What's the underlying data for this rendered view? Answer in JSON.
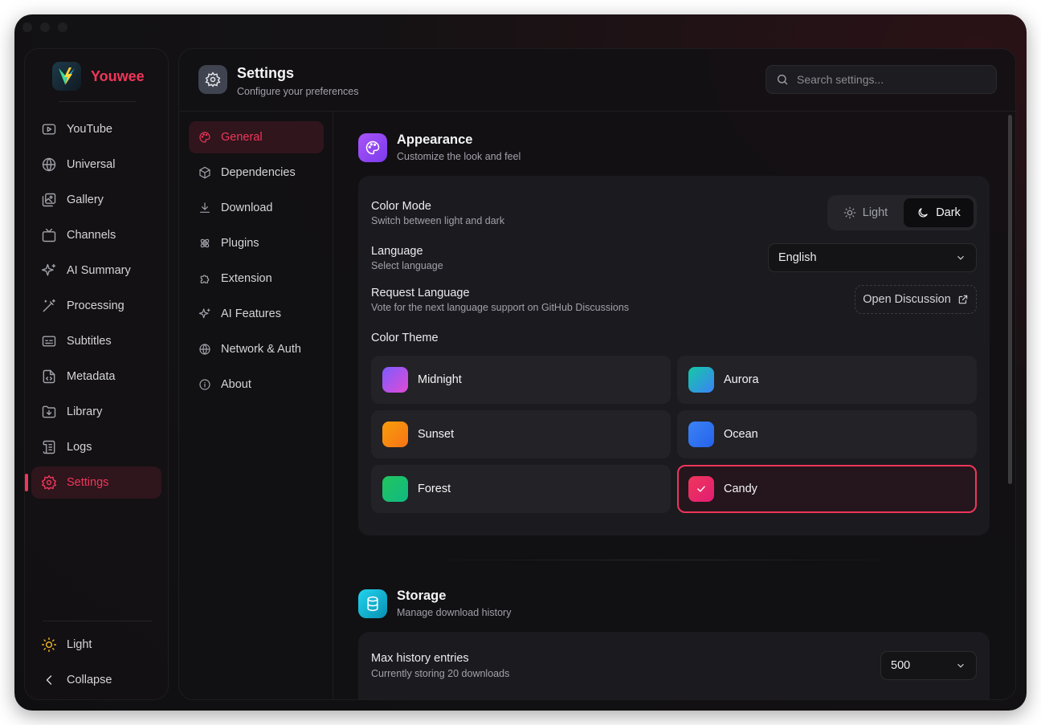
{
  "app": {
    "name": "Youwee",
    "brand_color": "#f0365a"
  },
  "sidebar": {
    "items": [
      {
        "label": "YouTube",
        "icon": "youtube-icon"
      },
      {
        "label": "Universal",
        "icon": "globe-icon"
      },
      {
        "label": "Gallery",
        "icon": "gallery-icon"
      },
      {
        "label": "Channels",
        "icon": "tv-icon"
      },
      {
        "label": "AI Summary",
        "icon": "sparkles-icon"
      },
      {
        "label": "Processing",
        "icon": "wand-icon"
      },
      {
        "label": "Subtitles",
        "icon": "subtitles-icon"
      },
      {
        "label": "Metadata",
        "icon": "file-code-icon"
      },
      {
        "label": "Library",
        "icon": "folder-download-icon"
      },
      {
        "label": "Logs",
        "icon": "scroll-icon"
      },
      {
        "label": "Settings",
        "icon": "gear-icon",
        "active": true
      }
    ],
    "theme_toggle_label": "Light",
    "collapse_label": "Collapse"
  },
  "header": {
    "title": "Settings",
    "subtitle": "Configure your preferences",
    "search_placeholder": "Search settings..."
  },
  "subnav": {
    "items": [
      {
        "label": "General",
        "icon": "palette-icon",
        "active": true
      },
      {
        "label": "Dependencies",
        "icon": "package-icon"
      },
      {
        "label": "Download",
        "icon": "download-icon"
      },
      {
        "label": "Plugins",
        "icon": "plugin-icon"
      },
      {
        "label": "Extension",
        "icon": "puzzle-icon"
      },
      {
        "label": "AI Features",
        "icon": "sparkles-icon"
      },
      {
        "label": "Network & Auth",
        "icon": "globe-icon"
      },
      {
        "label": "About",
        "icon": "info-icon"
      }
    ]
  },
  "appearance": {
    "title": "Appearance",
    "subtitle": "Customize the look and feel",
    "color_mode": {
      "label": "Color Mode",
      "description": "Switch between light and dark",
      "options": [
        "Light",
        "Dark"
      ],
      "selected": "Dark"
    },
    "language": {
      "label": "Language",
      "description": "Select language",
      "value": "English"
    },
    "request_language": {
      "label": "Request Language",
      "description": "Vote for the next language support on GitHub Discussions",
      "button": "Open Discussion"
    },
    "color_theme": {
      "label": "Color Theme",
      "themes": [
        {
          "name": "Midnight",
          "colors": [
            "#7c5cff",
            "#e24bd4"
          ]
        },
        {
          "name": "Aurora",
          "colors": [
            "#14c9a6",
            "#3b82f6"
          ]
        },
        {
          "name": "Sunset",
          "colors": [
            "#f59e0b",
            "#f97316"
          ]
        },
        {
          "name": "Ocean",
          "colors": [
            "#3b82f6",
            "#2563eb"
          ]
        },
        {
          "name": "Forest",
          "colors": [
            "#22c55e",
            "#10b981"
          ]
        },
        {
          "name": "Candy",
          "colors": [
            "#f0365a",
            "#e11d74"
          ],
          "selected": true
        }
      ]
    }
  },
  "storage": {
    "title": "Storage",
    "subtitle": "Manage download history",
    "max_history": {
      "label": "Max history entries",
      "description": "Currently storing 20 downloads",
      "value": "500"
    }
  }
}
